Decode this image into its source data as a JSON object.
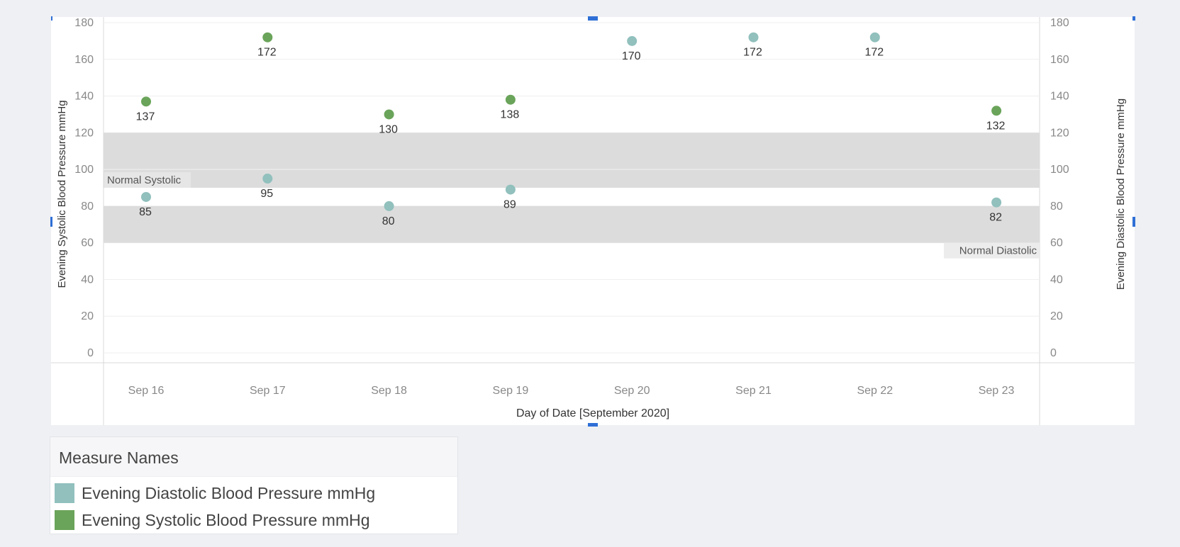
{
  "chart_data": {
    "type": "scatter",
    "title": "",
    "xlabel": "Day of Date [September 2020]",
    "ylabel_left": "Evening Systolic Blood Pressure mmHg",
    "ylabel_right": "Evening Diastolic Blood Pressure mmHg",
    "ylim": [
      0,
      180
    ],
    "yticks": [
      0,
      20,
      40,
      60,
      80,
      100,
      120,
      140,
      160,
      180
    ],
    "categories": [
      "Sep 16",
      "Sep 17",
      "Sep 18",
      "Sep 19",
      "Sep 20",
      "Sep 21",
      "Sep 22",
      "Sep 23"
    ],
    "series": [
      {
        "name": "Evening Systolic Blood Pressure mmHg",
        "color": "#6aa45a",
        "points": [
          {
            "x": "Sep 16",
            "y": 137
          },
          {
            "x": "Sep 17",
            "y": 172
          },
          {
            "x": "Sep 18",
            "y": 130
          },
          {
            "x": "Sep 19",
            "y": 138
          },
          {
            "x": "Sep 23",
            "y": 132
          }
        ]
      },
      {
        "name": "Evening Diastolic Blood Pressure mmHg",
        "color": "#91c0bd",
        "points": [
          {
            "x": "Sep 16",
            "y": 85
          },
          {
            "x": "Sep 17",
            "y": 95
          },
          {
            "x": "Sep 18",
            "y": 80
          },
          {
            "x": "Sep 19",
            "y": 89
          },
          {
            "x": "Sep 20",
            "y": 170
          },
          {
            "x": "Sep 21",
            "y": 172
          },
          {
            "x": "Sep 22",
            "y": 172
          },
          {
            "x": "Sep 23",
            "y": 82
          }
        ]
      }
    ],
    "reference_bands": [
      {
        "label": "Normal Systolic",
        "from": 90,
        "to": 120,
        "label_position": "left"
      },
      {
        "label": "Normal Diastolic",
        "from": 60,
        "to": 80,
        "label_position": "right"
      }
    ],
    "grid": true,
    "legend_position": "bottom-left"
  },
  "legend": {
    "title": "Measure Names",
    "items": [
      {
        "label": "Evening Diastolic Blood Pressure mmHg",
        "color": "#91c0bd"
      },
      {
        "label": "Evening Systolic Blood Pressure mmHg",
        "color": "#6aa45a"
      }
    ]
  }
}
